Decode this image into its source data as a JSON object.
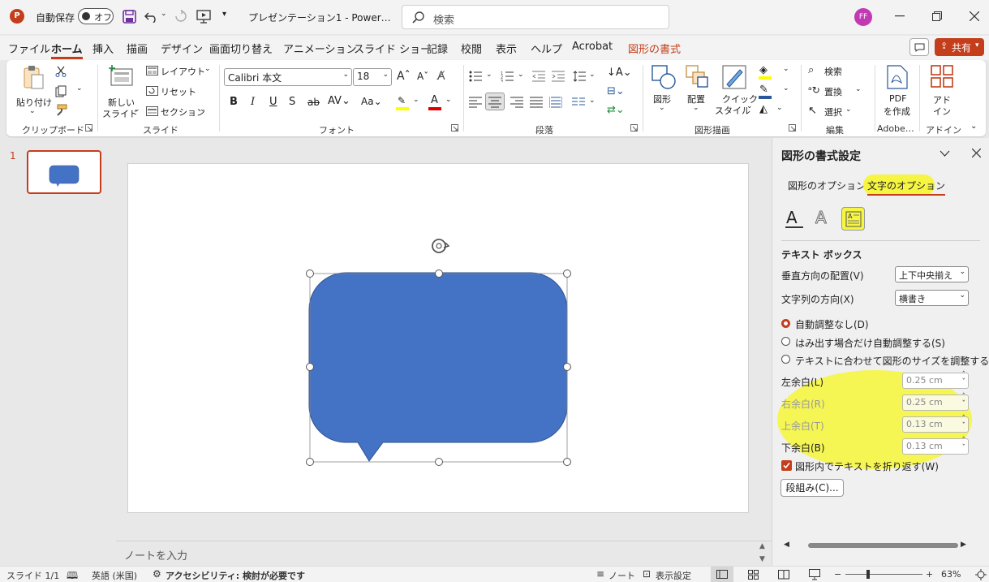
{
  "titlebar": {
    "autosave_label": "自動保存",
    "autosave_state": "オフ",
    "doc_title": "プレゼンテーション1 - Power…",
    "search_placeholder": "検索",
    "user_initials": "FF"
  },
  "menu": {
    "items": [
      "ファイル",
      "ホーム",
      "挿入",
      "描画",
      "デザイン",
      "画面切り替え",
      "アニメーション",
      "スライド ショー",
      "記録",
      "校閲",
      "表示",
      "ヘルプ",
      "Acrobat",
      "図形の書式"
    ],
    "share_label": "共有"
  },
  "ribbon": {
    "clipboard": {
      "paste": "貼り付け",
      "label": "クリップボード"
    },
    "slides": {
      "new_slide_1": "新しい",
      "new_slide_2": "スライド",
      "layout": "レイアウト",
      "reset": "リセット",
      "section": "セクション",
      "label": "スライド"
    },
    "font": {
      "font_name": "Calibri 本文",
      "font_size": "18",
      "label": "フォント"
    },
    "paragraph": {
      "label": "段落"
    },
    "drawing": {
      "shapes": "図形",
      "arrange": "配置",
      "quick_style_1": "クイック",
      "quick_style_2": "スタイル",
      "label": "図形描画"
    },
    "editing": {
      "find": "検索",
      "replace": "置換",
      "select": "選択",
      "label": "編集"
    },
    "adobe": {
      "pdf_1": "PDF",
      "pdf_2": "を作成",
      "label": "Adobe…"
    },
    "addin": {
      "l1": "アド",
      "l2": "イン",
      "label": "アドイン"
    }
  },
  "thumbs": {
    "slide_number": "1"
  },
  "notes": {
    "placeholder": "ノートを入力"
  },
  "pane": {
    "title": "図形の書式設定",
    "tab_shape": "図形のオプション",
    "tab_text": "文字のオプション",
    "section": "テキスト ボックス",
    "valign_label": "垂直方向の配置(V)",
    "valign_value": "上下中央揃え",
    "direction_label": "文字列の方向(X)",
    "direction_value": "横書き",
    "radio_1": "自動調整なし(D)",
    "radio_2": "はみ出す場合だけ自動調整する(S)",
    "radio_3": "テキストに合わせて図形のサイズを調整する(F)",
    "left_margin_label": "左余白(L)",
    "left_margin_value": "0.25 cm",
    "right_margin_label": "右余白(R)",
    "right_margin_value": "0.25 cm",
    "top_margin_label": "上余白(T)",
    "top_margin_value": "0.13 cm",
    "bottom_margin_label": "下余白(B)",
    "bottom_margin_value": "0.13 cm",
    "wrap_label": "図形内でテキストを折り返す(W)",
    "columns_button": "段組み(C)..."
  },
  "status": {
    "slide": "スライド 1/1",
    "language": "英語 (米国)",
    "accessibility": "アクセシビリティ: 検討が必要です",
    "notes": "ノート",
    "display": "表示設定",
    "zoom": "63%"
  },
  "colors": {
    "accent": "#c43e1c",
    "shape_fill": "#4472c4",
    "highlight": "#f5f542"
  }
}
